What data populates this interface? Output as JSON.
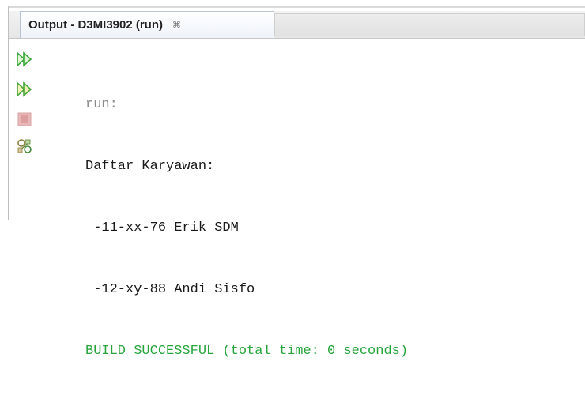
{
  "panel": {
    "tab_title": "Output - D3MI3902 (run)",
    "tab_close_glyph": "⌘"
  },
  "toolbar": {
    "buttons": [
      {
        "name": "rerun-icon",
        "color": "#3aa83a"
      },
      {
        "name": "rerun-with-options-icon",
        "color": "#3aa83a"
      },
      {
        "name": "stop-icon",
        "color": "#d4a0a0"
      },
      {
        "name": "settings-icon",
        "color": "#6a8a3a"
      }
    ]
  },
  "console": {
    "lines": [
      {
        "text": "run:",
        "kind": "run"
      },
      {
        "text": "Daftar Karyawan:",
        "kind": "normal"
      },
      {
        "text": " -11-xx-76 Erik SDM",
        "kind": "normal"
      },
      {
        "text": " -12-xy-88 Andi Sisfo",
        "kind": "normal"
      },
      {
        "text": "BUILD SUCCESSFUL (total time: 0 seconds)",
        "kind": "success"
      }
    ]
  }
}
